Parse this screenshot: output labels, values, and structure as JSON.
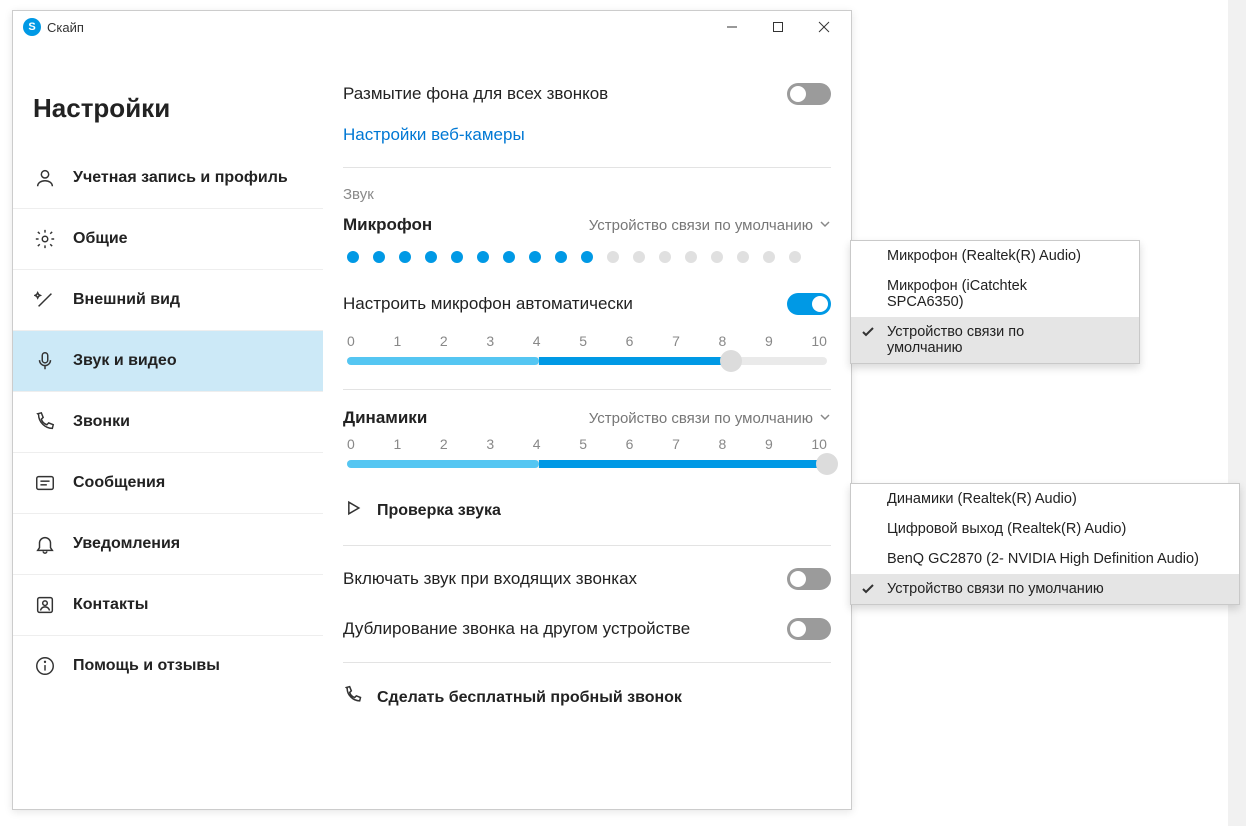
{
  "window": {
    "title": "Скайп"
  },
  "sidebar": {
    "heading": "Настройки",
    "items": [
      {
        "label": "Учетная запись и профиль"
      },
      {
        "label": "Общие"
      },
      {
        "label": "Внешний вид"
      },
      {
        "label": "Звук и видео"
      },
      {
        "label": "Звонки"
      },
      {
        "label": "Сообщения"
      },
      {
        "label": "Уведомления"
      },
      {
        "label": "Контакты"
      },
      {
        "label": "Помощь и отзывы"
      }
    ]
  },
  "content": {
    "blur_label": "Размытие фона для всех звонков",
    "webcam_link": "Настройки веб-камеры",
    "sound_section": "Звук",
    "mic_title": "Микрофон",
    "mic_device": "Устройство связи по умолчанию",
    "mic_level_dots": 10,
    "mic_total_dots": 18,
    "auto_mic_label": "Настроить микрофон автоматически",
    "slider_ticks": [
      "0",
      "1",
      "2",
      "3",
      "4",
      "5",
      "6",
      "7",
      "8",
      "9",
      "10"
    ],
    "mic_slider_value": 8,
    "speakers_title": "Динамики",
    "speakers_device": "Устройство связи по умолчанию",
    "speakers_slider_value": 10,
    "sound_check": "Проверка звука",
    "incoming_label": "Включать звук при входящих звонках",
    "duplicate_label": "Дублирование звонка на другом устройстве",
    "test_call": "Сделать бесплатный пробный звонок"
  },
  "mic_dropdown": {
    "items": [
      {
        "label": "Микрофон (Realtek(R) Audio)",
        "selected": false
      },
      {
        "label": "Микрофон (iCatchtek SPCA6350)",
        "selected": false
      },
      {
        "label": "Устройство связи по умолчанию",
        "selected": true
      }
    ]
  },
  "speakers_dropdown": {
    "items": [
      {
        "label": "Динамики (Realtek(R) Audio)",
        "selected": false
      },
      {
        "label": "Цифровой выход (Realtek(R) Audio)",
        "selected": false
      },
      {
        "label": "BenQ GC2870 (2- NVIDIA High Definition Audio)",
        "selected": false
      },
      {
        "label": "Устройство связи по умолчанию",
        "selected": true
      }
    ]
  }
}
